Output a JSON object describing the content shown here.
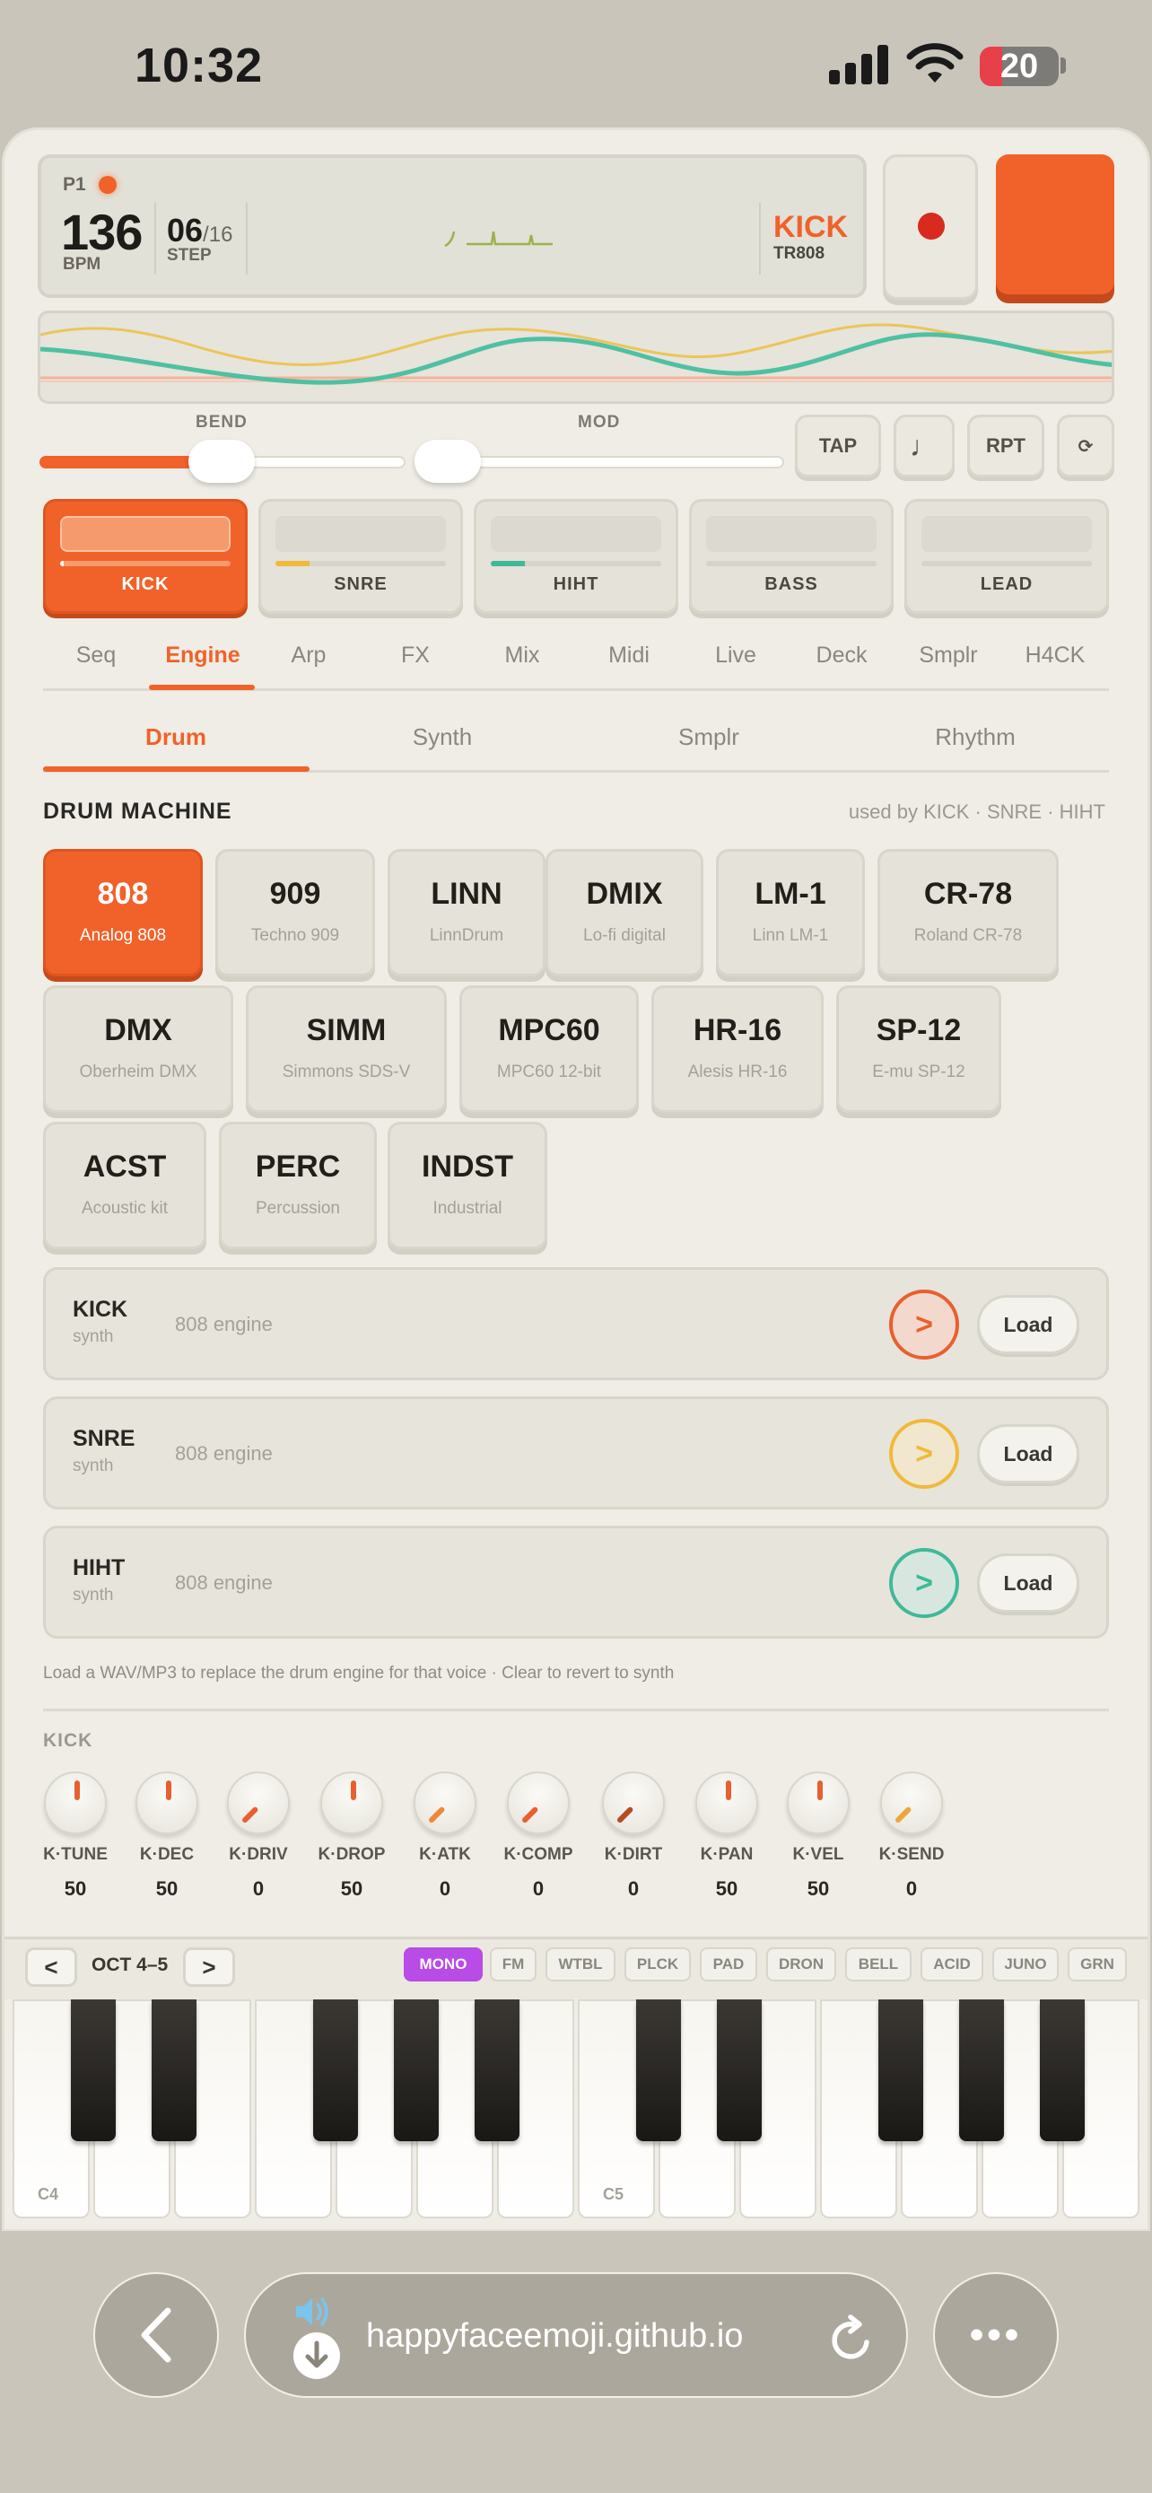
{
  "status": {
    "time": "10:32",
    "battery": "20"
  },
  "display": {
    "patch": "P1",
    "bpm": "136",
    "bpm_label": "BPM",
    "step_num": "06",
    "step_den": "/16",
    "step_label": "STEP",
    "voice": "KICK",
    "voice_sub": "TR808"
  },
  "sliders": {
    "bend_label": "BEND",
    "mod_label": "MOD",
    "bend_value": 0.5,
    "mod_value": 0.0
  },
  "buttons": {
    "tap": "TAP",
    "note": "♩",
    "rpt": "RPT",
    "loop": "⟳"
  },
  "voices": [
    {
      "name": "KICK",
      "level": 0.02,
      "color": "#ffffff"
    },
    {
      "name": "SNRE",
      "level": 0.2,
      "color": "#f0b93a"
    },
    {
      "name": "HIHT",
      "level": 0.2,
      "color": "#3fb99a"
    },
    {
      "name": "BASS",
      "level": 0,
      "color": "#8a877f"
    },
    {
      "name": "LEAD",
      "level": 0,
      "color": "#8a877f"
    }
  ],
  "tabs": [
    "Seq",
    "Engine",
    "Arp",
    "FX",
    "Mix",
    "Midi",
    "Live",
    "Deck",
    "Smplr",
    "H4CK"
  ],
  "subtabs": [
    "Drum",
    "Synth",
    "Smplr",
    "Rhythm"
  ],
  "drum_machine": {
    "title": "DRUM MACHINE",
    "used_by": "used by KICK · SNRE · HIHT",
    "kits": [
      {
        "name": "808",
        "desc": "Analog 808"
      },
      {
        "name": "909",
        "desc": "Techno 909"
      },
      {
        "name": "LINN",
        "desc": "LinnDrum"
      },
      {
        "name": "DMIX",
        "desc": "Lo-fi digital"
      },
      {
        "name": "LM-1",
        "desc": "Linn LM-1"
      },
      {
        "name": "CR-78",
        "desc": "Roland CR-78"
      },
      {
        "name": "DMX",
        "desc": "Oberheim DMX"
      },
      {
        "name": "SIMM",
        "desc": "Simmons SDS-V"
      },
      {
        "name": "MPC60",
        "desc": "MPC60 12-bit"
      },
      {
        "name": "HR-16",
        "desc": "Alesis HR-16"
      },
      {
        "name": "SP-12",
        "desc": "E-mu SP-12"
      },
      {
        "name": "ACST",
        "desc": "Acoustic kit"
      },
      {
        "name": "PERC",
        "desc": "Percussion"
      },
      {
        "name": "INDST",
        "desc": "Industrial"
      }
    ]
  },
  "samples": [
    {
      "name": "KICK",
      "sub": "synth",
      "engine": "808 engine",
      "color": "#e8602e",
      "load": "Load"
    },
    {
      "name": "SNRE",
      "sub": "synth",
      "engine": "808 engine",
      "color": "#f0b93a",
      "load": "Load"
    },
    {
      "name": "HIHT",
      "sub": "synth",
      "engine": "808 engine",
      "color": "#3fb99a",
      "load": "Load"
    }
  ],
  "hint": "Load a WAV/MP3 to replace the drum engine for that voice · Clear to revert to synth",
  "knob_section": "KICK",
  "knobs": [
    {
      "label": "K·TUNE",
      "value": "50",
      "angle": 0
    },
    {
      "label": "K·DEC",
      "value": "50",
      "angle": 0
    },
    {
      "label": "K·DRIV",
      "value": "0",
      "angle": -135
    },
    {
      "label": "K·DROP",
      "value": "50",
      "angle": 0
    },
    {
      "label": "K·ATK",
      "value": "0",
      "angle": -135
    },
    {
      "label": "K·COMP",
      "value": "0",
      "angle": -135
    },
    {
      "label": "K·DIRT",
      "value": "0",
      "angle": -135
    },
    {
      "label": "K·PAN",
      "value": "50",
      "angle": 0
    },
    {
      "label": "K·VEL",
      "value": "50",
      "angle": 0
    },
    {
      "label": "K·SEND",
      "value": "0",
      "angle": -135
    }
  ],
  "keyboard": {
    "octave": "OCT 4–5",
    "prev": "<",
    "next": ">",
    "presets": [
      "MONO",
      "FM",
      "WTBL",
      "PLCK",
      "PAD",
      "DRON",
      "BELL",
      "ACID",
      "JUNO",
      "GRN"
    ],
    "c4": "C4",
    "c5": "C5"
  },
  "browser": {
    "url": "happyfaceemoji.github.io"
  },
  "colors": {
    "accent": "#f0622a",
    "preset_active": "#b94be6"
  }
}
